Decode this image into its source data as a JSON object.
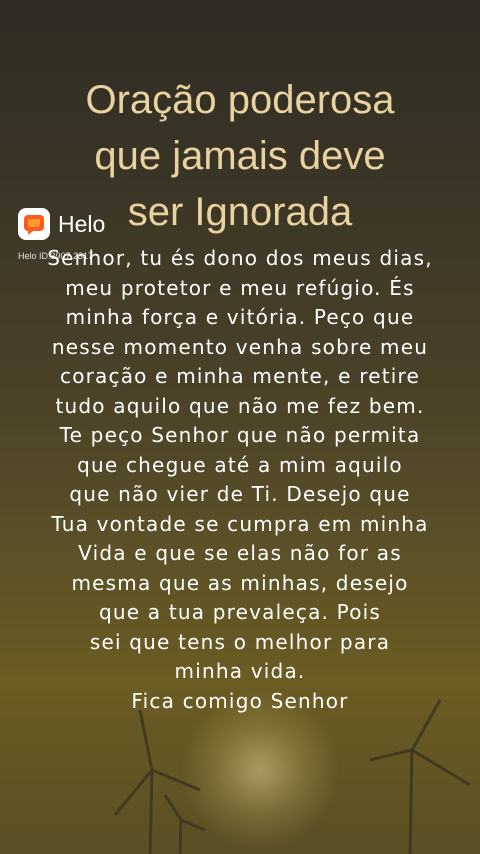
{
  "title_lines": [
    "Oração poderosa",
    "que jamais deve",
    "ser Ignorada"
  ],
  "prayer_lines": [
    "Senhor, tu és dono dos meus dias,",
    "meu protetor e meu refúgio. És",
    "minha força e vitória. Peço que",
    "nesse momento venha sobre meu",
    "coração e minha mente, e retire",
    "tudo aquilo que não me fez bem.",
    "Te peço Senhor que não permita",
    "que chegue até a mim aquilo",
    "que não vier de Ti. Desejo que",
    "Tua vontade se cumpra em minha",
    "Vida e que se elas não for as",
    "mesma que as minhas, desejo",
    "que a tua prevaleça. Pois",
    "sei que tens o melhor para",
    "minha vida.",
    "Fica comigo Senhor"
  ],
  "watermark": {
    "app_name": "Helo",
    "user_id": "Helo ID:3907 2317",
    "icon": "helo-logo-icon",
    "colors": {
      "icon_primary": "#ff5a1f",
      "icon_secondary": "#ff9a2e"
    }
  }
}
